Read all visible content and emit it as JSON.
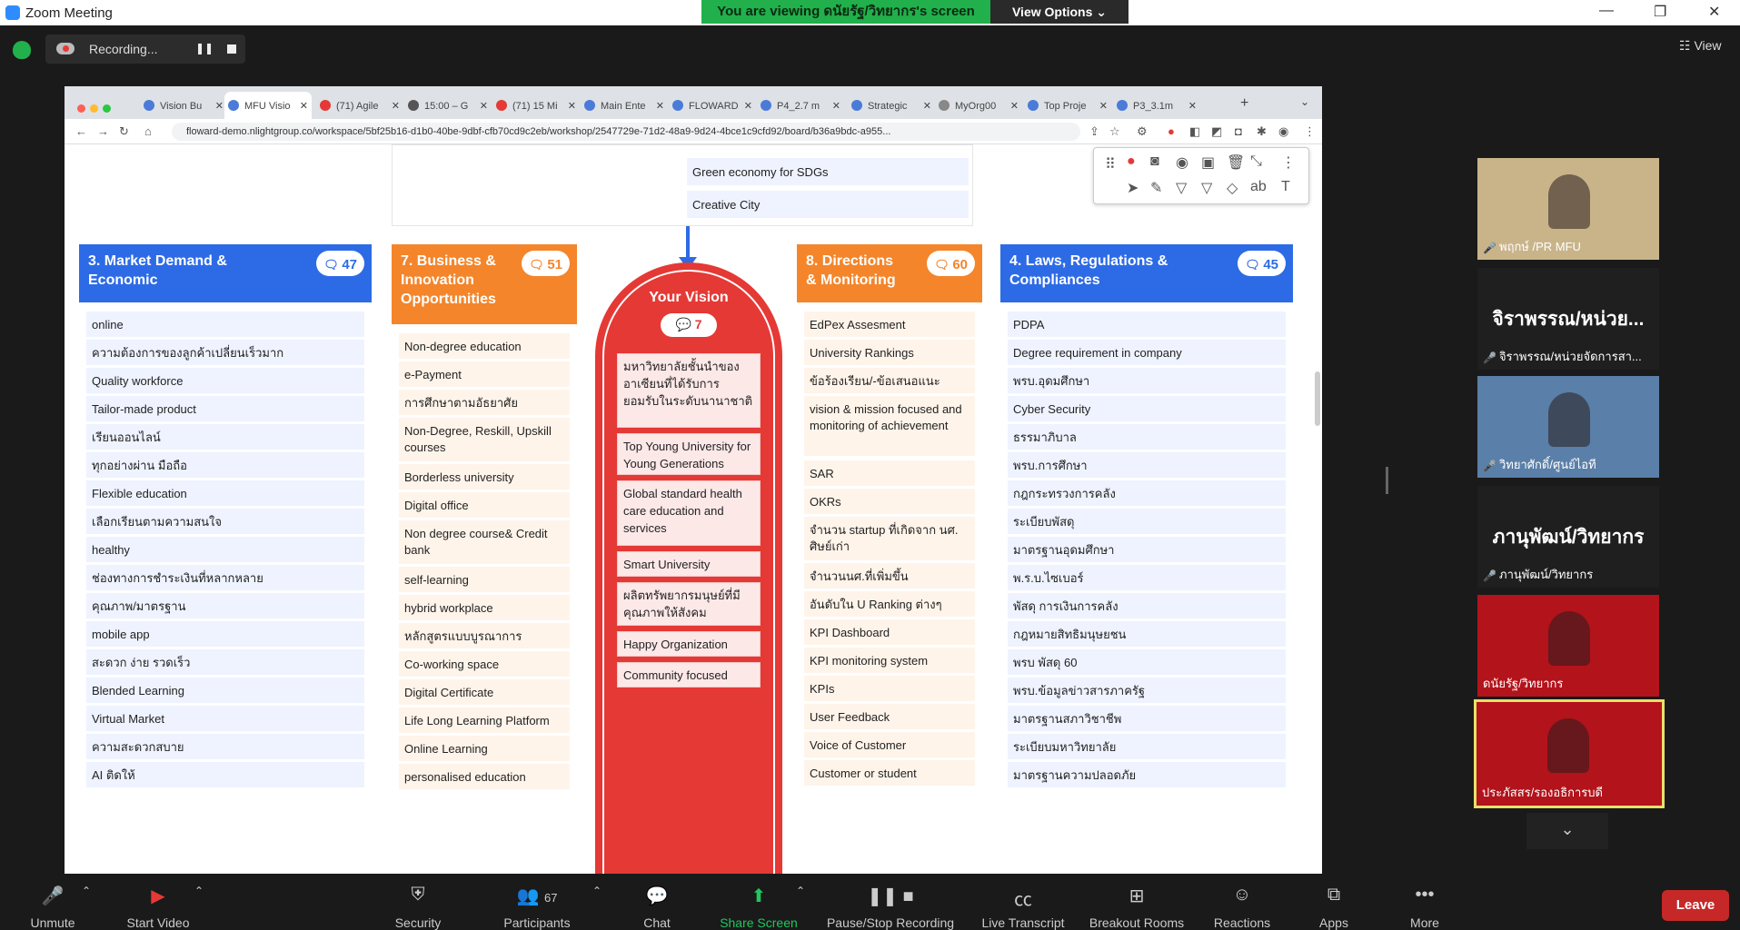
{
  "window": {
    "title": "Zoom Meeting",
    "minimize": "—",
    "restore": "❐",
    "close": "✕"
  },
  "banner": {
    "viewing": "You are viewing ดนัยรัฐ/วิทยากร's screen",
    "view_options": "View Options ⌄"
  },
  "recording": {
    "label": "Recording...",
    "pause": "❚❚"
  },
  "view_button": "☷ View",
  "browser": {
    "tabs": [
      {
        "label": "Vision Bu",
        "color": "#4a7bd8"
      },
      {
        "label": "MFU Visio",
        "color": "#4a7bd8"
      },
      {
        "label": "(71) Agile",
        "color": "#e53935"
      },
      {
        "label": "15:00 – G",
        "color": "#555555"
      },
      {
        "label": "(71) 15 Mi",
        "color": "#e53935"
      },
      {
        "label": "Main Ente",
        "color": "#4a7bd8"
      },
      {
        "label": "FLOWARD",
        "color": "#4a7bd8"
      },
      {
        "label": "P4_2.7 m",
        "color": "#4a7bd8"
      },
      {
        "label": "Strategic",
        "color": "#4a7bd8"
      },
      {
        "label": "MyOrg00",
        "color": "#888888"
      },
      {
        "label": "Top Proje",
        "color": "#4a7bd8"
      },
      {
        "label": "P3_3.1m",
        "color": "#4a7bd8"
      }
    ],
    "new_tab": "+",
    "url": "floward-demo.nlightgroup.co/workspace/5bf25b16-d1b0-40be-9dbf-cfb70cd9c2eb/workshop/2547729e-71d2-48a9-9d24-4bce1c9cfd92/board/b36a9bdc-a955..."
  },
  "board": {
    "top_items": [
      "Green economy for SDGs",
      "Creative City"
    ],
    "columns": [
      {
        "title": "3. Market Demand & Economic",
        "count": "47",
        "color": "#2d6be6",
        "item_bg": "#eef3ff",
        "items": [
          "online",
          "ความต้องการของลูกค้าเปลี่ยนเร็วมาก",
          "Quality workforce",
          "Tailor-made product",
          "เรียนออนไลน์",
          "ทุกอย่างผ่าน มือถือ",
          "Flexible education",
          "เลือกเรียนตามความสนใจ",
          "healthy",
          "ช่องทางการชำระเงินที่หลากหลาย",
          "คุณภาพ/มาตรฐาน",
          "mobile app",
          "สะดวก ง่าย รวดเร็ว",
          "Blended Learning",
          "Virtual Market",
          "ความสะดวกสบาย",
          "AI ติดให้"
        ]
      },
      {
        "title": "7. Business & Innovation Opportunities",
        "count": "51",
        "color": "#f4852a",
        "item_bg": "#fff4ea",
        "items": [
          "Non-degree education",
          "e-Payment",
          "การศึกษาตามอัธยาศัย",
          "Non-Degree, Reskill, Upskill courses",
          "Borderless university",
          "Digital office",
          "Non degree course& Credit bank",
          "self-learning",
          "hybrid workplace",
          "หลักสูตรแบบบูรณาการ",
          "Co-working space",
          "Digital Certificate",
          "Life Long Learning Platform",
          "Online Learning",
          "personalised education"
        ]
      },
      {
        "title": "8. Directions & Monitoring",
        "count": "60",
        "color": "#f4852a",
        "item_bg": "#fff4ea",
        "items": [
          "EdPex Assesment",
          "University Rankings",
          "ข้อร้องเรียน/-ข้อเสนอแนะ",
          "vision & mission focused and monitoring of achievement",
          "SAR",
          "OKRs",
          "จำนวน startup ที่เกิดจาก นศ. ศิษย์เก่า",
          "จำนวนนศ.ที่เพิ่มขึ้น",
          "อันดับใน U Ranking ต่างๆ",
          "KPI Dashboard",
          "KPI monitoring system",
          "KPIs",
          "User Feedback",
          "Voice of Customer",
          "Customer or student"
        ]
      },
      {
        "title": "4. Laws, Regulations & Compliances",
        "count": "45",
        "color": "#2d6be6",
        "item_bg": "#eef3ff",
        "items": [
          "PDPA",
          "Degree requirement in company",
          "พรบ.อุดมศึกษา",
          "Cyber Security",
          "ธรรมาภิบาล",
          "พรบ.การศึกษา",
          "กฎกระทรวงการคลัง",
          "ระเบียบพัสดุ",
          "มาตรฐานอุดมศึกษา",
          "พ.ร.บ.ไซเบอร์",
          "พัสดุ การเงินการคลัง",
          "กฎหมายสิทธิมนุษยชน",
          "พรบ พัสดุ 60",
          "พรบ.ข้อมูลข่าวสารภาครัฐ",
          "มาตรฐานสภาวิชาชีพ",
          "ระเบียบมหาวิทยาลัย",
          "มาตรฐานความปลอดภัย"
        ]
      }
    ],
    "vision": {
      "title": "Your Vision",
      "count": "7",
      "items": [
        "มหาวิทยาลัยชั้นนำของอาเซียนที่ได้รับการยอมรับในระดับนานาชาติ",
        "Top Young University for Young Generations",
        "Global standard health care education and services",
        "Smart University",
        "ผลิตทรัพยากรมนุษย์ที่มีคุณภาพให้สังคม",
        "Happy Organization",
        "Community focused"
      ]
    }
  },
  "participants_panel": [
    {
      "name": "พฤกษ์ /PR MFU",
      "big": "",
      "bg": "#c9b48a"
    },
    {
      "name": "จิราพรรณ/หน่วยจัดการสา...",
      "big": "จิราพรรณ/หน่วย...",
      "bg": "#1f1f1f"
    },
    {
      "name": "วิทยาศักดิ์/ศูนย์ไอที",
      "big": "",
      "bg": "#5a7fa8"
    },
    {
      "name": "ภานุพัฒน์/วิทยากร",
      "big": "ภานุพัฒน์/วิทยากร",
      "bg": "#1f1f1f"
    },
    {
      "name": "ดนัยรัฐ/วิทยากร",
      "big": "",
      "bg": "#b3131b"
    },
    {
      "name": "ประภัสสร/รองอธิการบดี",
      "big": "",
      "bg": "#b3131b"
    }
  ],
  "toolbar": {
    "unmute": "Unmute",
    "start_video": "Start Video",
    "security": "Security",
    "participants": "Participants",
    "participants_count": "67",
    "chat": "Chat",
    "share_screen": "Share Screen",
    "recording": "Pause/Stop Recording",
    "live_transcript": "Live Transcript",
    "breakout_rooms": "Breakout Rooms",
    "reactions": "Reactions",
    "apps": "Apps",
    "more": "More",
    "leave": "Leave"
  }
}
